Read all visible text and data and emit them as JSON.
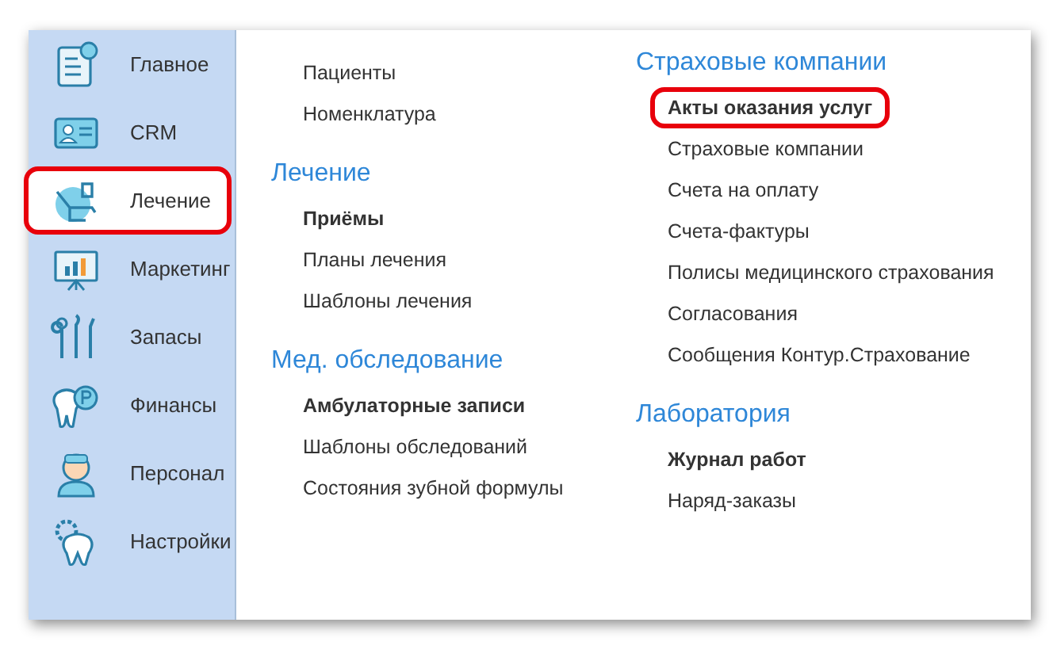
{
  "sidebar": {
    "items": [
      {
        "label": "Главное",
        "selected": false
      },
      {
        "label": "CRM",
        "selected": false
      },
      {
        "label": "Лечение",
        "selected": true
      },
      {
        "label": "Маркетинг",
        "selected": false
      },
      {
        "label": "Запасы",
        "selected": false
      },
      {
        "label": "Финансы",
        "selected": false
      },
      {
        "label": "Персонал",
        "selected": false
      },
      {
        "label": "Настройки",
        "selected": false
      }
    ]
  },
  "columns": [
    {
      "groups": [
        {
          "items": [
            {
              "label": "Пациенты",
              "bold": false,
              "circled": false
            },
            {
              "label": "Номенклатура",
              "bold": false,
              "circled": false
            }
          ]
        },
        {
          "heading": "Лечение",
          "items": [
            {
              "label": "Приёмы",
              "bold": true,
              "circled": false
            },
            {
              "label": "Планы лечения",
              "bold": false,
              "circled": false
            },
            {
              "label": "Шаблоны лечения",
              "bold": false,
              "circled": false
            }
          ]
        },
        {
          "heading": "Мед. обследование",
          "items": [
            {
              "label": "Амбулаторные записи",
              "bold": true,
              "circled": false
            },
            {
              "label": "Шаблоны обследований",
              "bold": false,
              "circled": false
            },
            {
              "label": "Состояния зубной формулы",
              "bold": false,
              "circled": false
            }
          ]
        }
      ]
    },
    {
      "groups": [
        {
          "heading": "Страховые компании",
          "items": [
            {
              "label": "Акты оказания услуг",
              "bold": true,
              "circled": true
            },
            {
              "label": "Страховые компании",
              "bold": false,
              "circled": false
            },
            {
              "label": "Счета на оплату",
              "bold": false,
              "circled": false
            },
            {
              "label": "Счета-фактуры",
              "bold": false,
              "circled": false
            },
            {
              "label": "Полисы медицинского страхования",
              "bold": false,
              "circled": false
            },
            {
              "label": "Согласования",
              "bold": false,
              "circled": false
            },
            {
              "label": "Сообщения Контур.Страхование",
              "bold": false,
              "circled": false
            }
          ]
        },
        {
          "heading": "Лаборатория",
          "items": [
            {
              "label": "Журнал работ",
              "bold": true,
              "circled": false
            },
            {
              "label": "Наряд-заказы",
              "bold": false,
              "circled": false
            }
          ]
        }
      ]
    }
  ]
}
